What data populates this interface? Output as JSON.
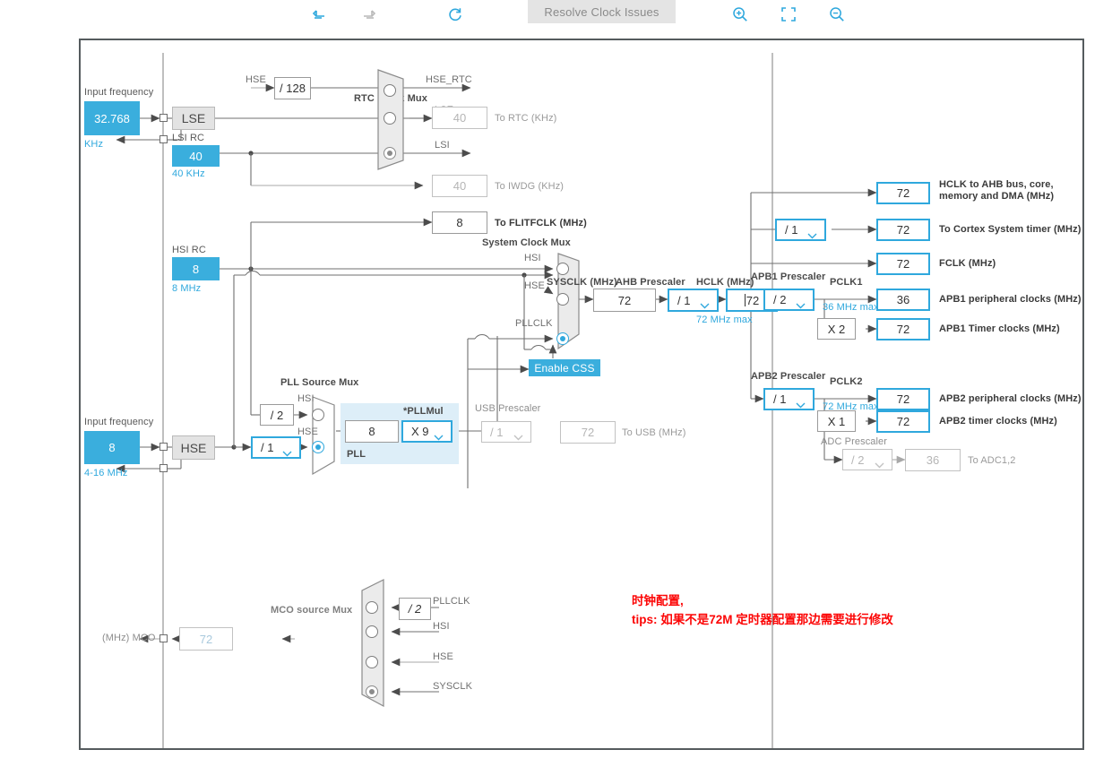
{
  "toolbar": {
    "icons": [
      {
        "name": "undo-icon",
        "label": "Undo",
        "state": "enabled"
      },
      {
        "name": "redo-icon",
        "label": "Redo",
        "state": "disabled"
      },
      {
        "name": "refresh-icon",
        "label": "Refresh",
        "state": "enabled"
      },
      {
        "name": "zoom-in-icon",
        "label": "Zoom In",
        "state": "enabled"
      },
      {
        "name": "fit-screen-icon",
        "label": "Fit to Screen",
        "state": "enabled"
      },
      {
        "name": "zoom-out-icon",
        "label": "Zoom Out",
        "state": "enabled"
      }
    ],
    "resolve_button": "Resolve Clock Issues"
  },
  "colors": {
    "accent_blue": "#2fa8dd",
    "fill_blue": "#3aaedd",
    "pll_panel": "#ddeef8",
    "annotation_red": "#fc0606",
    "canvas_border": "#555b5e",
    "disabled_gray": "#b5b5b5"
  },
  "lse": {
    "input_frequency_label": "Input frequency",
    "value": "32.768",
    "unit": "KHz",
    "osc_label": "LSE"
  },
  "lsi": {
    "title": "LSI RC",
    "value": "40",
    "unit": "40 KHz"
  },
  "hsi": {
    "title": "HSI RC",
    "value": "8",
    "unit": "8 MHz"
  },
  "hse": {
    "input_frequency_label": "Input frequency",
    "value": "8",
    "range": "4-16 MHz",
    "osc_label": "HSE",
    "divider": "/ 1"
  },
  "rtc_mux": {
    "title": "RTC Clock Mux",
    "hse_div_label": "HSE",
    "hse_divider": "/ 128",
    "inputs": [
      {
        "label": "HSE_RTC",
        "selected": false
      },
      {
        "label": "LSE",
        "selected": false
      },
      {
        "label": "LSI",
        "selected": true
      }
    ]
  },
  "outputs_left": [
    {
      "name": "to-rtc",
      "value": "40",
      "label": "To RTC (KHz)",
      "state": "disabled"
    },
    {
      "name": "to-iwdg",
      "value": "40",
      "label": "To IWDG (KHz)",
      "state": "disabled"
    },
    {
      "name": "to-flitfclk",
      "value": "8",
      "label": "To FLITFCLK (MHz)",
      "state": "enabled"
    }
  ],
  "pll": {
    "source_mux_title": "PLL Source Mux",
    "hsi_div": "/ 2",
    "inputs": [
      {
        "label": "HSI",
        "selected": false
      },
      {
        "label": "HSE",
        "selected": true
      }
    ],
    "panel_label": "PLL",
    "input_value": "8",
    "pllmul_label": "*PLLMul",
    "pllmul_value": "X 9"
  },
  "usb": {
    "prescaler_title": "USB Prescaler",
    "prescaler_value": "/ 1",
    "out_value": "72",
    "out_label": "To USB (MHz)"
  },
  "sysclk_mux": {
    "title": "System Clock Mux",
    "inputs": [
      {
        "label": "HSI",
        "selected": false
      },
      {
        "label": "HSE",
        "selected": false
      },
      {
        "label": "PLLCLK",
        "selected": true
      }
    ],
    "css_button": "Enable CSS"
  },
  "sysclk": {
    "title": "SYSCLK (MHz)",
    "value": "72"
  },
  "ahb": {
    "title": "AHB Prescaler",
    "value": "/ 1"
  },
  "hclk": {
    "title": "HCLK (MHz)",
    "value": "72",
    "max_note": "72 MHz max"
  },
  "ahb_outputs": [
    {
      "name": "hclk-to-ahb",
      "value": "72",
      "label": "HCLK to AHB bus, core,\nmemory and DMA (MHz)",
      "state": "enabled"
    },
    {
      "name": "cortex-system-timer",
      "value": "72",
      "label": "To Cortex System timer (MHz)",
      "state": "enabled",
      "prescaler": "/ 1"
    },
    {
      "name": "fclk",
      "value": "72",
      "label": "FCLK (MHz)",
      "state": "enabled"
    }
  ],
  "apb1": {
    "prescaler_title": "APB1 Prescaler",
    "prescaler_value": "/ 2",
    "pclk_label": "PCLK1",
    "max_note": "36 MHz max",
    "multiplier": "X 2",
    "peripheral_value": "36",
    "peripheral_label": "APB1 peripheral clocks (MHz)",
    "timer_value": "72",
    "timer_label": "APB1 Timer clocks (MHz)"
  },
  "apb2": {
    "prescaler_title": "APB2 Prescaler",
    "prescaler_value": "/ 1",
    "pclk_label": "PCLK2",
    "max_note": "72 MHz max",
    "multiplier": "X 1",
    "peripheral_value": "72",
    "peripheral_label": "APB2 peripheral clocks (MHz)",
    "timer_value": "72",
    "timer_label": "APB2 timer clocks (MHz)"
  },
  "adc": {
    "prescaler_title": "ADC Prescaler",
    "prescaler_value": "/ 2",
    "out_value": "36",
    "out_label": "To ADC1,2"
  },
  "mco": {
    "title": "MCO source Mux",
    "pin_label": "(MHz) MCO",
    "out_value": "72",
    "pllclk_div": "/ 2",
    "inputs": [
      {
        "label": "PLLCLK",
        "selected": false
      },
      {
        "label": "HSI",
        "selected": false
      },
      {
        "label": "HSE",
        "selected": false
      },
      {
        "label": "SYSCLK",
        "selected": true
      }
    ]
  },
  "annotation": {
    "text": "时钟配置,\ntips: 如果不是72M 定时器配置那边需要进行修改"
  }
}
